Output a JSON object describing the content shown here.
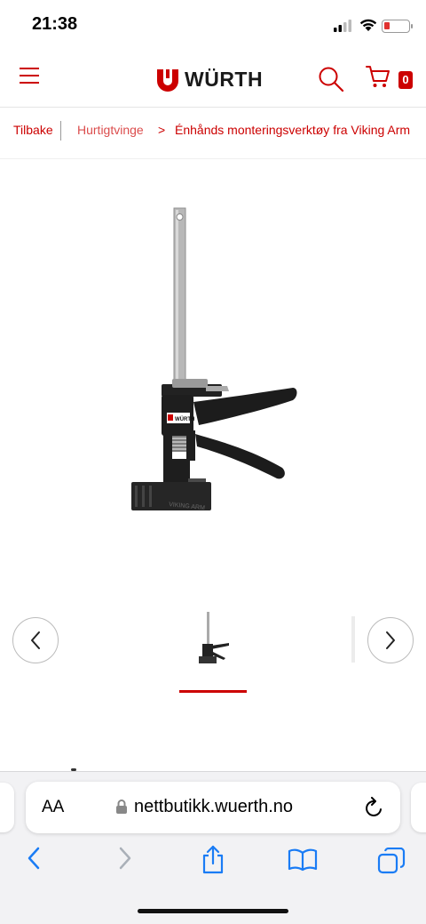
{
  "status_bar": {
    "time": "21:38",
    "battery_color": "#e0312f"
  },
  "header": {
    "logo_text": "WÜRTH",
    "brand_color": "#cc0000",
    "cart_count": "0",
    "icons": [
      "menu-icon",
      "wurth-logo-icon",
      "search-icon",
      "cart-icon"
    ]
  },
  "breadcrumb": {
    "back_label": "Tilbake",
    "parent_label": "Hurtigtvinge",
    "separator": ">",
    "current_label": "Énhånds monteringsverktøy fra Viking Arm"
  },
  "product": {
    "image_label": "WÜRTH",
    "base_text": "VIKING ARM"
  },
  "carousel": {
    "prev_icon": "chevron-left-icon",
    "next_icon": "chevron-right-icon",
    "active_index": 1
  },
  "browser": {
    "text_size_label": "AA",
    "url": "nettbutikk.wuerth.no",
    "toolbar_icons": [
      "back-icon",
      "forward-icon",
      "share-icon",
      "bookmarks-icon",
      "tabs-icon"
    ]
  }
}
